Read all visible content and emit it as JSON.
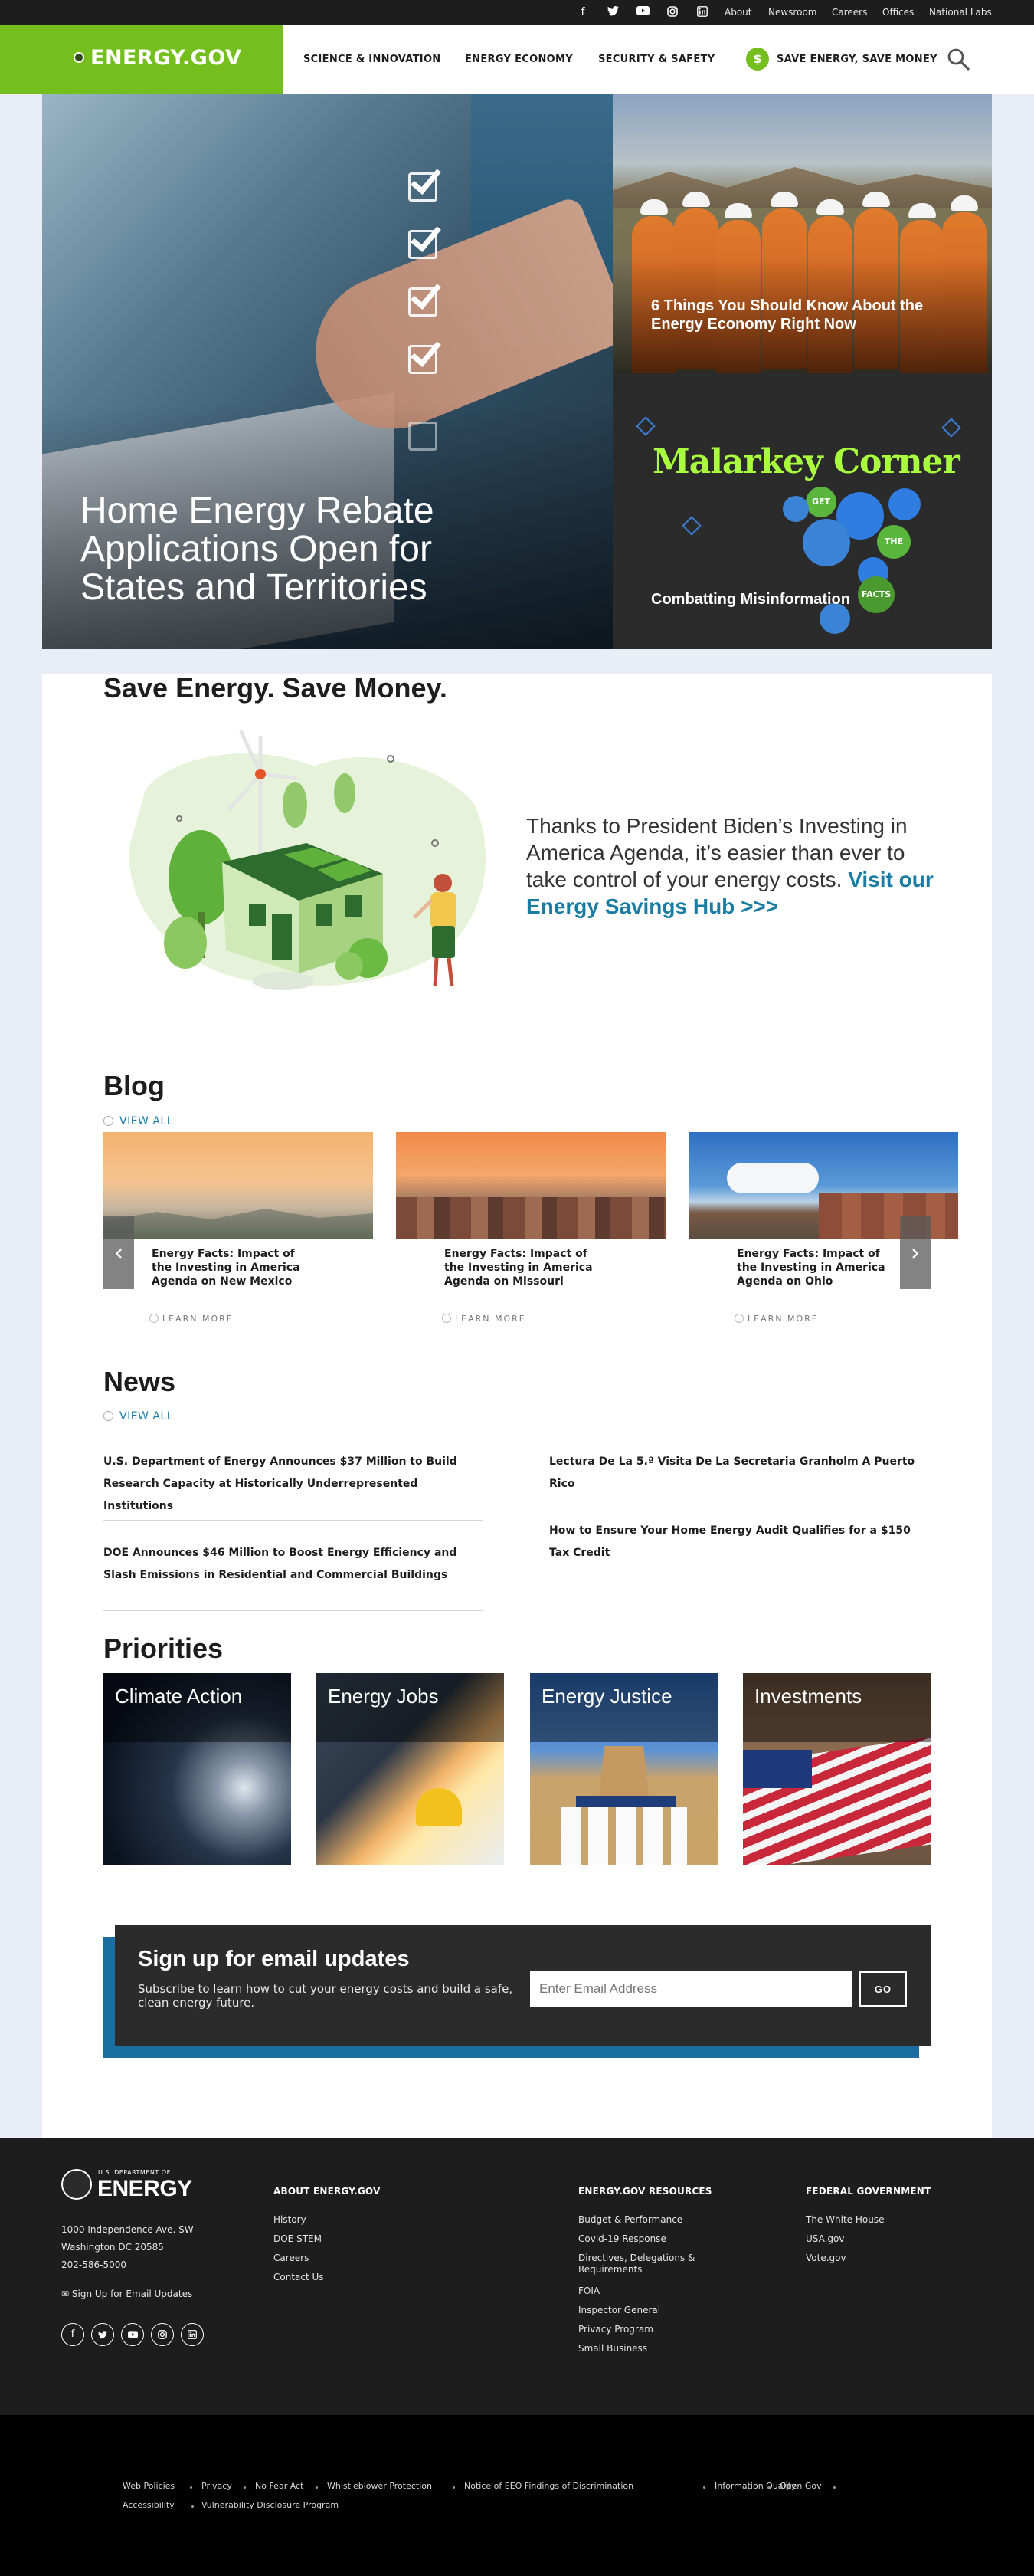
{
  "utility_bar": {
    "social_icons": [
      "facebook-icon",
      "twitter-icon",
      "youtube-icon",
      "instagram-icon",
      "linkedin-icon"
    ],
    "links": [
      "About",
      "Newsroom",
      "Careers",
      "Offices",
      "National Labs"
    ]
  },
  "header": {
    "logo": "ENERGY.GOV",
    "nav": [
      "SCIENCE & INNOVATION",
      "ENERGY ECONOMY",
      "SECURITY & SAFETY"
    ],
    "save_label": "SAVE ENERGY, SAVE MONEY",
    "brand_color": "#74bf1e"
  },
  "hero": {
    "main_title": "Home Energy Rebate Applications Open for States and Territories",
    "side1_title": "6 Things You Should Know About the Energy Economy Right Now",
    "side2_title": "Combatting Misinformation",
    "side2_graphic_text": "Malarkey Corner",
    "side2_bubbles": [
      "GET",
      "THE",
      "FACTS"
    ]
  },
  "savings": {
    "title": "Save Energy. Save Money.",
    "text": "Thanks to President Biden’s Investing in America Agenda, it’s easier than ever to take control of your energy costs.",
    "link": "Visit our Energy Savings Hub >>>"
  },
  "blog": {
    "title": "Blog",
    "view_all": "VIEW ALL",
    "learn_more": "LEARN MORE",
    "items": [
      {
        "title": "Energy Facts: Impact of the Investing in America Agenda on New Mexico"
      },
      {
        "title": "Energy Facts: Impact of the Investing in America Agenda on Missouri"
      },
      {
        "title": "Energy Facts: Impact of the Investing in America Agenda on Ohio"
      }
    ]
  },
  "news": {
    "title": "News",
    "view_all": "VIEW ALL",
    "items": [
      "U.S. Department of Energy Announces $37 Million to Build Research Capacity at Historically Underrepresented Institutions",
      "Lectura De La 5.ª Visita De La Secretaria Granholm A Puerto Rico",
      "DOE Announces $46 Million to Boost Energy Efficiency and Slash Emissions in Residential and Commercial Buildings",
      "How to Ensure Your Home Energy Audit Qualifies for a $150 Tax Credit"
    ]
  },
  "priorities": {
    "title": "Priorities",
    "items": [
      "Climate Action",
      "Energy Jobs",
      "Energy Justice",
      "Investments"
    ]
  },
  "signup": {
    "title": "Sign up for email updates",
    "subtitle": "Subscribe to learn how to cut your energy costs and build a safe, clean energy future.",
    "placeholder": "Enter Email Address",
    "button": "GO"
  },
  "footer": {
    "brand_top": "U.S. DEPARTMENT OF",
    "brand": "ENERGY",
    "address": [
      "1000 Independence Ave. SW",
      "Washington DC 20585",
      "202-586-5000"
    ],
    "email_signup": "Sign Up for Email Updates",
    "social_icons": [
      "facebook-icon",
      "twitter-icon",
      "youtube-icon",
      "instagram-icon",
      "linkedin-icon"
    ],
    "columns": [
      {
        "title": "ABOUT ENERGY.GOV",
        "links": [
          "History",
          "DOE STEM",
          "Careers",
          "Contact Us"
        ]
      },
      {
        "title": "ENERGY.GOV RESOURCES",
        "links": [
          "Budget & Performance",
          "Covid-19 Response",
          "Directives, Delegations & Requirements",
          "FOIA",
          "Inspector General",
          "Privacy Program",
          "Small Business"
        ]
      },
      {
        "title": "FEDERAL GOVERNMENT",
        "links": [
          "The White House",
          "USA.gov",
          "Vote.gov"
        ]
      }
    ],
    "bottom_links": [
      "Web Policies",
      "Privacy",
      "No Fear Act",
      "Whistleblower Protection",
      "Notice of EEO Findings of Discrimination",
      "Information Quality",
      "Open Gov",
      "Accessibility",
      "Vulnerability Disclosure Program"
    ]
  }
}
